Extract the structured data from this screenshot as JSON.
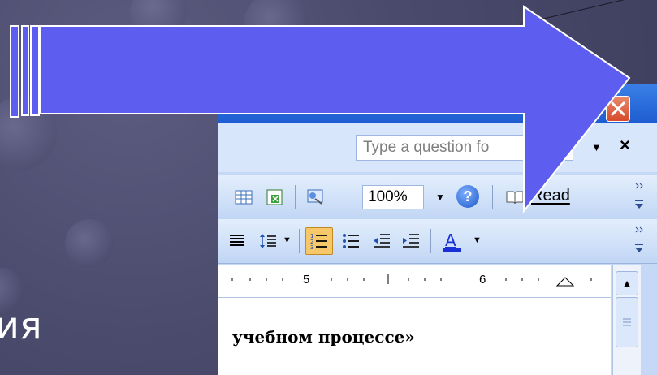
{
  "slide": {
    "partial_text": "ия"
  },
  "word": {
    "help": {
      "placeholder": "Type a question for help",
      "visible_text": "Type a question fo",
      "close": "×",
      "dropdown": "▼"
    },
    "toolbar": {
      "zoom_value": "100%",
      "zoom_arrow": "▼",
      "help_glyph": "?",
      "read_label": "Read"
    },
    "ruler": {
      "marks": [
        "5",
        "6"
      ]
    },
    "document": {
      "visible_text": "учебном процессе»"
    },
    "window_buttons": {
      "close_glyph": "X"
    }
  },
  "icons": [
    "restore-icon",
    "close-icon",
    "table-icon",
    "excel-icon",
    "drawing-icon",
    "zoom-dropdown-icon",
    "help-icon",
    "read-icon",
    "toolbar-options-icon",
    "align-justify-icon",
    "line-spacing-icon",
    "numbering-icon",
    "bullets-icon",
    "decrease-indent-icon",
    "increase-indent-icon",
    "font-color-icon",
    "scroll-up-icon",
    "scroll-thumb-icon",
    "big-arrow-icon"
  ],
  "colors": {
    "slide_bg": "#4a4a6c",
    "arrow_fill": "#5d5ef0",
    "title_bar": "#1c5bd0",
    "close_btn": "#d64a2a",
    "font_color_underline": "#1a2fd6"
  }
}
